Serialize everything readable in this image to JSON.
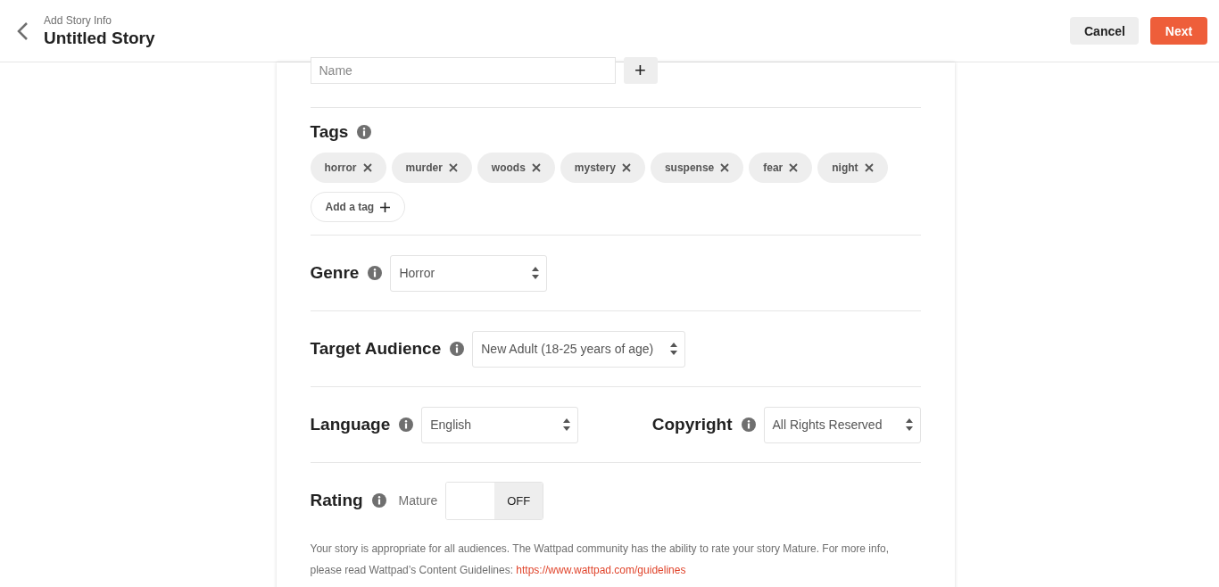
{
  "header": {
    "subtitle": "Add Story Info",
    "title": "Untitled Story",
    "buttons": [
      {
        "label": "Cancel",
        "kind": "secondary"
      },
      {
        "label": "Next",
        "kind": "primary"
      }
    ]
  },
  "character": {
    "placeholder": "Name",
    "add": "+"
  },
  "tags": {
    "label": "Tags",
    "items": [
      "horror",
      "murder",
      "woods",
      "mystery",
      "suspense",
      "fear",
      "night"
    ],
    "add_label": "Add a tag"
  },
  "fields": [
    {
      "label": "Genre",
      "value": "Horror"
    },
    {
      "label": "Target Audience",
      "value": "New Adult (18-25 years of age)"
    }
  ],
  "language": {
    "label": "Language",
    "value": "English"
  },
  "copyright": {
    "label": "Copyright",
    "value": "All Rights Reserved"
  },
  "rating": {
    "label": "Rating",
    "toggle_label": "Mature",
    "on": false,
    "state_text": "OFF",
    "description": "Your story is appropriate for all audiences. The Wattpad community has the ability to rate your story Mature. For more info, please read Wattpad’s Content Guidelines:",
    "link": "https://www.wattpad.com/guidelines"
  }
}
